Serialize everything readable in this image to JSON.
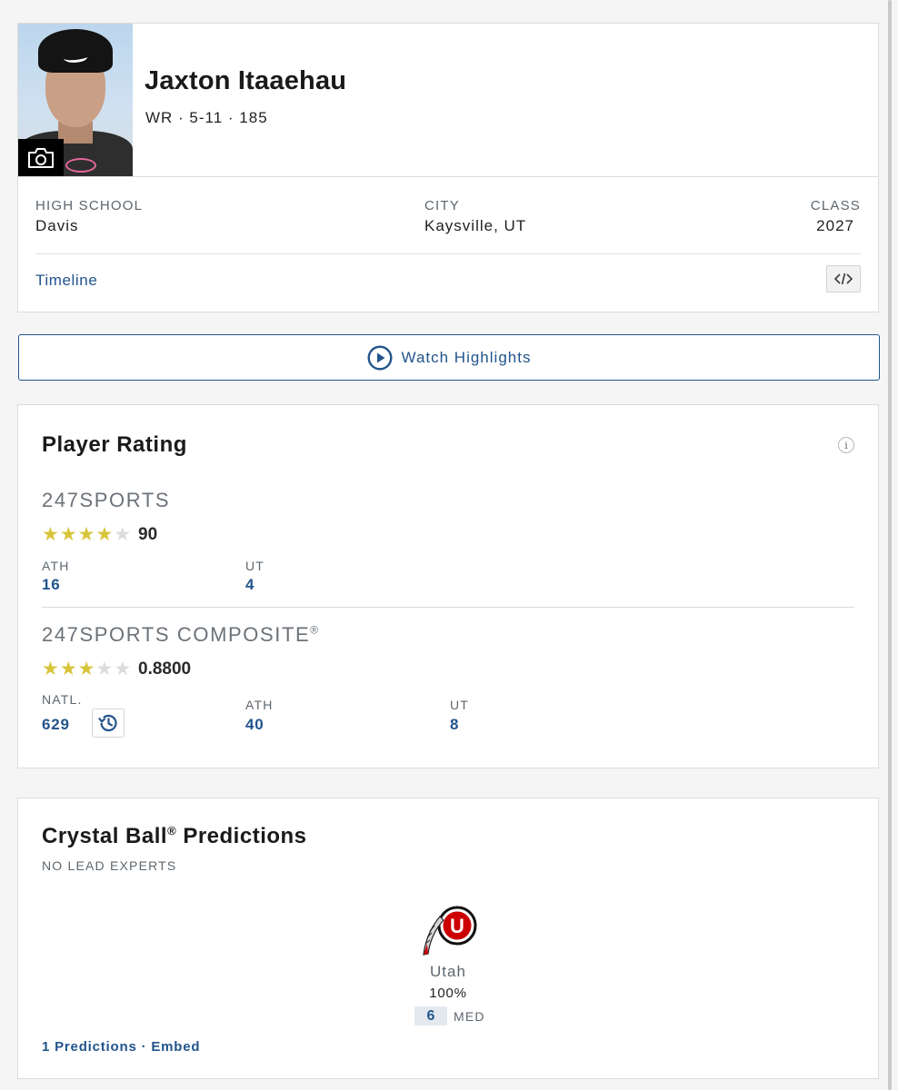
{
  "player": {
    "name": "Jaxton Itaaehau",
    "meta": "WR · 5-11 · 185"
  },
  "details": {
    "high_school_label": "HIGH SCHOOL",
    "high_school": "Davis",
    "city_label": "CITY",
    "city": "Kaysville, UT",
    "class_label": "CLASS",
    "class": "2027",
    "timeline_link": "Timeline"
  },
  "highlights": {
    "label": "Watch Highlights"
  },
  "rating": {
    "title": "Player Rating",
    "info_glyph": "i",
    "sports247": {
      "title": "247SPORTS",
      "stars_filled": 4,
      "stars_total": 5,
      "score": "90",
      "ranks": [
        {
          "label": "ATH",
          "value": "16"
        },
        {
          "label": "UT",
          "value": "4"
        }
      ]
    },
    "composite": {
      "title": "247SPORTS COMPOSITE",
      "trademark": "®",
      "stars_filled": 3,
      "stars_total": 5,
      "score": "0.8800",
      "ranks": [
        {
          "label": "NATL.",
          "value": "629"
        },
        {
          "label": "ATH",
          "value": "40"
        },
        {
          "label": "UT",
          "value": "8"
        }
      ]
    }
  },
  "crystal_ball": {
    "title": "Crystal Ball",
    "trademark": "®",
    "title_suffix": " Predictions",
    "lead_experts": "NO LEAD EXPERTS",
    "team": {
      "name": "Utah",
      "logo_letter": "U",
      "percent": "100%",
      "confidence": "6",
      "confidence_label": "MED"
    },
    "predictions_link": "1 Predictions",
    "separator": " · ",
    "embed_link": "Embed"
  },
  "colors": {
    "link_blue": "#22548c",
    "star_gold": "#d8c43a",
    "utah_red": "#cc0000"
  },
  "icons": [
    "camera-icon",
    "embed-code-icon",
    "play-circle-icon",
    "info-icon",
    "star-icon",
    "history-icon",
    "utah-logo"
  ]
}
